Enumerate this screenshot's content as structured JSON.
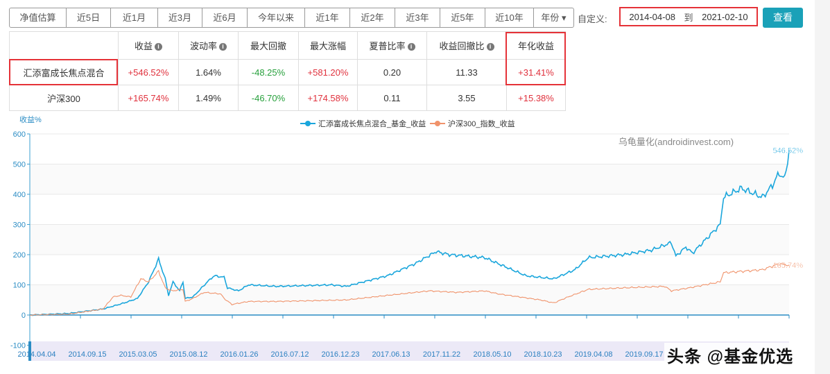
{
  "toolbar": {
    "periods": [
      "净值估算",
      "近5日",
      "近1月",
      "近3月",
      "近6月",
      "今年以来",
      "近1年",
      "近2年",
      "近3年",
      "近5年",
      "近10年",
      "年份"
    ],
    "custom_label": "自定义:",
    "start_date": "2014-04-08",
    "to_label": "到",
    "end_date": "2021-02-10",
    "view_button": "查看"
  },
  "table": {
    "headers": [
      "",
      "收益",
      "波动率",
      "最大回撤",
      "最大涨幅",
      "夏普比率",
      "收益回撤比",
      "年化收益"
    ],
    "info_cols": [
      1,
      2,
      5,
      6
    ],
    "rows": [
      [
        "汇添富成长焦点混合",
        "+546.52%",
        "1.64%",
        "-48.25%",
        "+581.20%",
        "0.20",
        "11.33",
        "+31.41%"
      ],
      [
        "沪深300",
        "+165.74%",
        "1.49%",
        "-46.70%",
        "+174.58%",
        "0.11",
        "3.55",
        "+15.38%"
      ]
    ]
  },
  "colors": {
    "fund": "#1aa6dc",
    "index": "#f0936b",
    "accent": "#1aa1b8",
    "highlight": "#e53238",
    "up": "#e0313d",
    "down": "#27a03c"
  },
  "watermark": "头条 @基金优选",
  "chart_data": {
    "type": "line",
    "ylabel": "收益%",
    "ylim": [
      -100,
      600
    ],
    "yticks": [
      -100,
      0,
      100,
      200,
      300,
      400,
      500,
      600
    ],
    "source_text": "乌龟量化(androidinvest.com)",
    "xlim": [
      2014.27,
      2021.11
    ],
    "xticks": [
      "2014.04.04",
      "2014.09.15",
      "2015.03.05",
      "2015.08.12",
      "2016.01.26",
      "2016.07.12",
      "2016.12.23",
      "2017.06.13",
      "2017.11.22",
      "2018.05.10",
      "2018.10.23",
      "2019.04.08",
      "2019.09.17"
    ],
    "series": [
      {
        "name": "汇添富成长焦点混合_基金_收益",
        "end_label": "546.52%",
        "points": [
          [
            2014.27,
            0
          ],
          [
            2014.62,
            5
          ],
          [
            2014.93,
            20
          ],
          [
            2015.12,
            40
          ],
          [
            2015.24,
            55
          ],
          [
            2015.34,
            110
          ],
          [
            2015.43,
            185
          ],
          [
            2015.49,
            120
          ],
          [
            2015.52,
            65
          ],
          [
            2015.56,
            110
          ],
          [
            2015.62,
            80
          ],
          [
            2015.65,
            110
          ],
          [
            2015.67,
            55
          ],
          [
            2015.74,
            60
          ],
          [
            2015.87,
            110
          ],
          [
            2015.93,
            130
          ],
          [
            2016.02,
            125
          ],
          [
            2016.05,
            90
          ],
          [
            2016.15,
            80
          ],
          [
            2016.24,
            100
          ],
          [
            2016.49,
            95
          ],
          [
            2016.99,
            100
          ],
          [
            2017.12,
            95
          ],
          [
            2017.49,
            130
          ],
          [
            2017.74,
            170
          ],
          [
            2017.93,
            210
          ],
          [
            2018.05,
            200
          ],
          [
            2018.37,
            190
          ],
          [
            2018.49,
            170
          ],
          [
            2018.74,
            130
          ],
          [
            2018.99,
            120
          ],
          [
            2019.18,
            150
          ],
          [
            2019.3,
            190
          ],
          [
            2019.62,
            200
          ],
          [
            2019.87,
            215
          ],
          [
            2020.05,
            240
          ],
          [
            2020.09,
            195
          ],
          [
            2020.18,
            225
          ],
          [
            2020.24,
            205
          ],
          [
            2020.49,
            300
          ],
          [
            2020.52,
            390
          ],
          [
            2020.68,
            420
          ],
          [
            2020.87,
            390
          ],
          [
            2020.96,
            430
          ],
          [
            2021.02,
            470
          ],
          [
            2021.07,
            450
          ],
          [
            2021.11,
            546.52
          ]
        ]
      },
      {
        "name": "沪深300_指数_收益",
        "end_label": "165.74%",
        "points": [
          [
            2014.27,
            0
          ],
          [
            2014.62,
            3
          ],
          [
            2014.93,
            20
          ],
          [
            2015.02,
            60
          ],
          [
            2015.09,
            65
          ],
          [
            2015.18,
            60
          ],
          [
            2015.27,
            120
          ],
          [
            2015.34,
            110
          ],
          [
            2015.43,
            145
          ],
          [
            2015.49,
            90
          ],
          [
            2015.55,
            80
          ],
          [
            2015.65,
            85
          ],
          [
            2015.67,
            45
          ],
          [
            2015.74,
            55
          ],
          [
            2015.84,
            75
          ],
          [
            2015.99,
            70
          ],
          [
            2016.02,
            55
          ],
          [
            2016.09,
            35
          ],
          [
            2016.24,
            45
          ],
          [
            2016.49,
            45
          ],
          [
            2017.12,
            50
          ],
          [
            2017.49,
            65
          ],
          [
            2017.87,
            80
          ],
          [
            2018.12,
            75
          ],
          [
            2018.37,
            80
          ],
          [
            2018.49,
            70
          ],
          [
            2018.87,
            50
          ],
          [
            2018.99,
            40
          ],
          [
            2019.12,
            60
          ],
          [
            2019.3,
            85
          ],
          [
            2019.62,
            90
          ],
          [
            2019.99,
            95
          ],
          [
            2020.05,
            80
          ],
          [
            2020.21,
            90
          ],
          [
            2020.49,
            110
          ],
          [
            2020.52,
            140
          ],
          [
            2020.87,
            150
          ],
          [
            2021.02,
            170
          ],
          [
            2021.11,
            165.74
          ]
        ]
      }
    ]
  }
}
